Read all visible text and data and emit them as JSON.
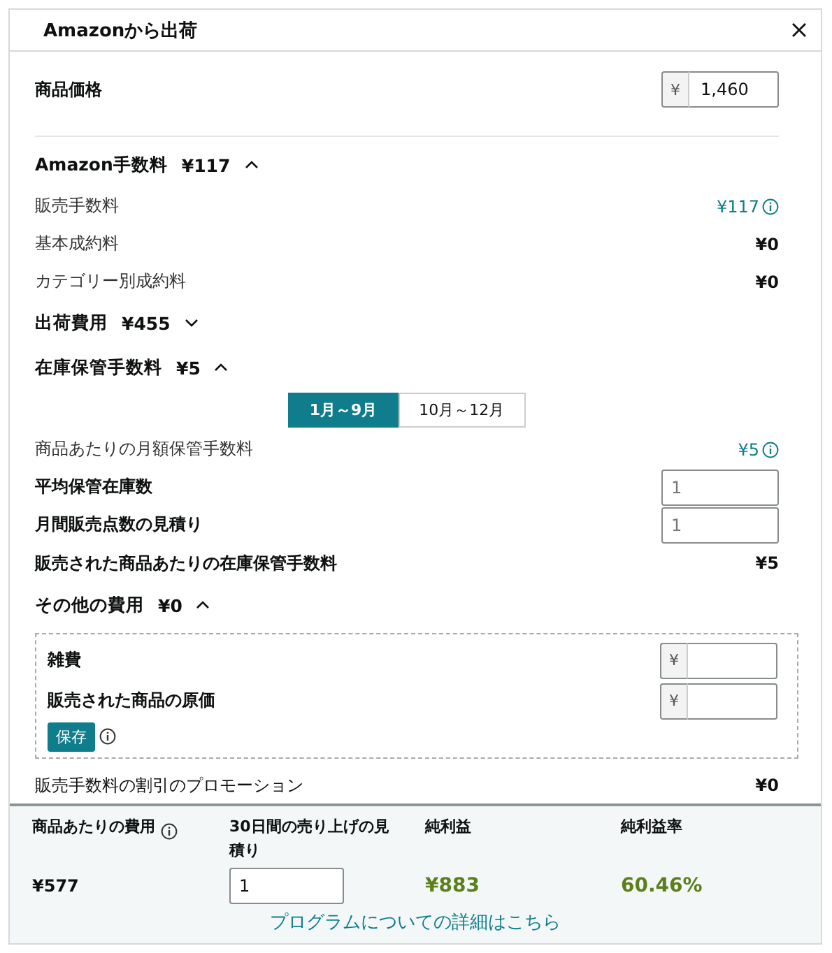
{
  "window": {
    "title": "Amazonから出荷"
  },
  "price": {
    "label": "商品価格",
    "currency": "¥",
    "value": "1,460"
  },
  "sections": [
    {
      "title": "Amazon手数料",
      "amount": "¥117",
      "expanded": true,
      "rows": [
        {
          "kind": "fee",
          "label": "販売手数料",
          "value": "¥117",
          "info": true
        },
        {
          "kind": "fee",
          "label": "基本成約料",
          "value": "¥0",
          "info": false
        },
        {
          "kind": "fee",
          "label": "カテゴリー別成約料",
          "value": "¥0",
          "info": false
        }
      ]
    },
    {
      "title": "出荷費用",
      "amount": "¥455",
      "expanded": false
    },
    {
      "title": "在庫保管手数料",
      "amount": "¥5",
      "expanded": true,
      "periods": [
        {
          "label": "1月～9月",
          "selected": true
        },
        {
          "label": "10月～12月",
          "selected": false
        }
      ],
      "rows": [
        {
          "kind": "fee",
          "label": "商品あたりの月額保管手数料",
          "value": "¥5",
          "info": true
        },
        {
          "kind": "input",
          "label": "平均保管在庫数",
          "placeholder": "1"
        },
        {
          "kind": "input",
          "label": "月間販売点数の見積り",
          "placeholder": "1"
        },
        {
          "kind": "total",
          "label": "販売された商品あたりの在庫保管手数料",
          "value": "¥5"
        }
      ]
    },
    {
      "title": "その他の費用",
      "amount": "¥0",
      "expanded": true,
      "costs": [
        {
          "label": "雑費",
          "currency": "¥"
        },
        {
          "label": "販売された商品の原価",
          "currency": "¥"
        }
      ],
      "save": "保存"
    }
  ],
  "promotion": {
    "label": "販売手数料の割引のプロモーション",
    "value": "¥0"
  },
  "summary": [
    {
      "kind": "value",
      "heading": "商品あたりの費用",
      "info": true,
      "value": "¥577"
    },
    {
      "kind": "input",
      "heading": "30日間の売り上げの見積り",
      "info": false,
      "value": "1"
    },
    {
      "kind": "profit",
      "heading": "純利益",
      "info": false,
      "value": "¥883"
    },
    {
      "kind": "profit",
      "heading": "純利益率",
      "info": false,
      "value": "60.46%"
    }
  ],
  "link": "プログラムについての詳細はこちら"
}
